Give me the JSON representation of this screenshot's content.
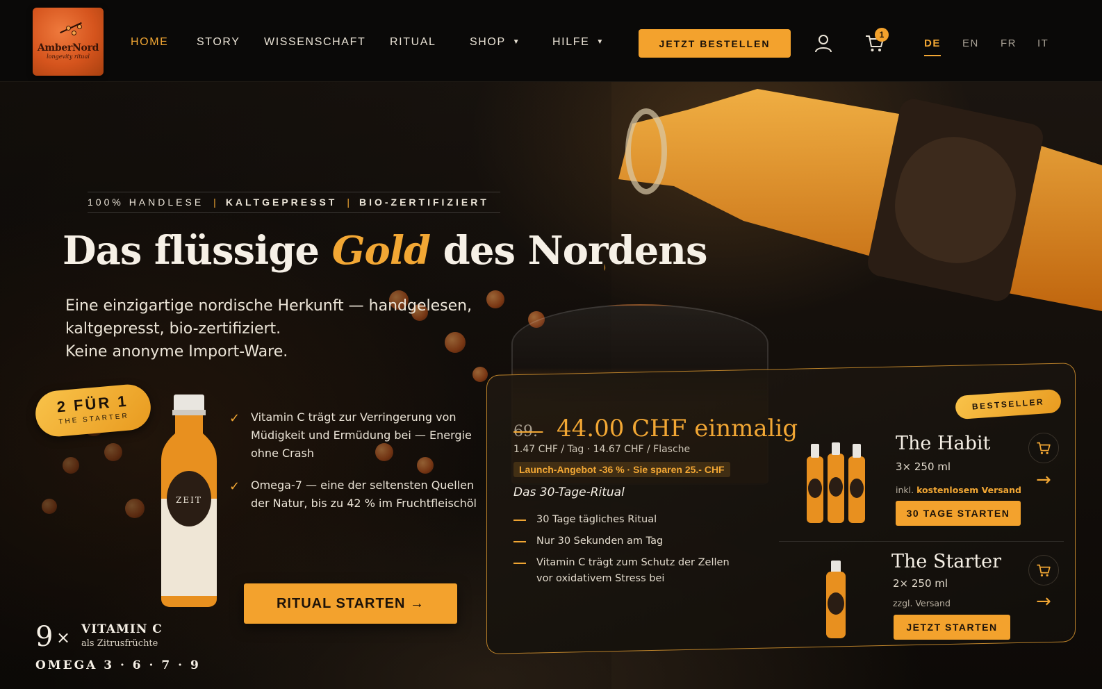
{
  "logo": {
    "brand": "AmberNord",
    "sub": "longevity ritual"
  },
  "nav": {
    "items": [
      "HOME",
      "STORY",
      "WISSENSCHAFT",
      "RITUAL",
      "SHOP",
      "HILFE"
    ],
    "active": "HOME",
    "cta": "JETZT BESTELLEN",
    "cart_count": "1",
    "languages": [
      "DE",
      "EN",
      "FR",
      "IT"
    ],
    "active_language": "DE"
  },
  "hero": {
    "tagline": [
      "100% HANDLESE",
      "KALTGEPRESST",
      "BIO-ZERTIFIZIERT"
    ],
    "headline_pre": "Das flüssige",
    "headline_gold": "Gold",
    "headline_post": "des Nordens",
    "sub_line1": "Eine einzigartige nordische Herkunft — handgelesen,",
    "sub_line2": "kaltgepresst, bio-zertifiziert.",
    "sub_line3": "Keine anonyme Import-Ware.",
    "badge_big": "2 FÜR 1",
    "badge_small": "THE STARTER",
    "benefits": [
      "Vitamin C trägt zur Verringerung von Müdigkeit und Ermüdung bei — Energie ohne Crash",
      "Omega-7 — eine der seltensten Quellen der Natur, bis zu 42 % im Fruchtfleischöl"
    ],
    "cta": "RITUAL STARTEN →",
    "stat_num": "9",
    "stat_times": "×",
    "stat_title": "VITAMIN C",
    "stat_sub": "als Zitrusfrüchte",
    "stat_omega": "OMEGA 3 · 6 · 7 · 9"
  },
  "offer": {
    "price_old": "69.-",
    "price_now": "44.00 CHF einmalig",
    "unit_price": "1.47 CHF / Tag  ·  14.67 CHF / Flasche",
    "launch": "Launch-Angebot -36 % · Sie sparen 25.- CHF",
    "ritual_title": "Das 30-Tage-Ritual",
    "ritual_items": [
      "30 Tage tägliches Ritual",
      "Nur 30 Sekunden am Tag",
      "Vitamin C trägt zum Schutz der Zellen vor oxidativem Stress  bei"
    ],
    "bestseller": "BESTSELLER",
    "products": [
      {
        "name": "The Habit",
        "size": "3× 250 ml",
        "ship_pre": "inkl.",
        "ship_hl": "kostenlosem Versand",
        "button": "30 TAGE STARTEN"
      },
      {
        "name": "The Starter",
        "size": "2× 250 ml",
        "ship_pre": "zzgl. Versand",
        "ship_hl": "",
        "button": "JETZT STARTEN"
      }
    ]
  },
  "colors": {
    "accent": "#f2a734",
    "button": "#f3a22d",
    "background": "#0a0908"
  },
  "icons": [
    "user-icon",
    "cart-icon",
    "check-icon",
    "arrow-right-icon"
  ]
}
